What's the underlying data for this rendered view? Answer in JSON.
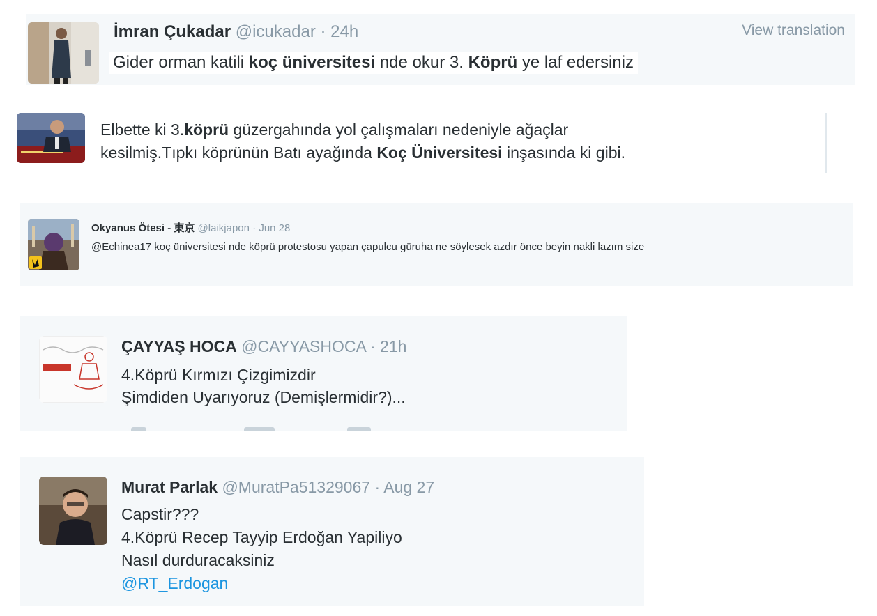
{
  "tweets": [
    {
      "name": "İmran Çukadar",
      "handle": "@icukadar",
      "sep": " · ",
      "time": "24h",
      "view_translation": "View translation",
      "text_1": "Gider orman katili ",
      "kw_1": "koç üniversitesi",
      "text_2": " nde okur 3. ",
      "kw_2": "Köprü",
      "text_3": " ye laf edersiniz"
    },
    {
      "line1_a": "Elbette ki 3.",
      "line1_kw": "köprü",
      "line1_b": " güzergahında yol çalışmaları nedeniyle ağaçlar",
      "line2_a": "kesilmiş.Tıpkı köprünün Batı ayağında ",
      "line2_kw": "Koç Üniversitesi",
      "line2_b": " inşasında ki gibi."
    },
    {
      "name": "Okyanus Ötesi - 東京",
      "handle": "@laikjapon",
      "sep": " · ",
      "time": "Jun 28",
      "text": "@Echinea17 koç üniversitesi nde köprü protestosu yapan çapulcu güruha ne söylesek azdır önce beyin nakli lazım size"
    },
    {
      "name": "ÇAYYAŞ HOCA",
      "handle": "@CAYYASHOCA",
      "sep": " · ",
      "time": "21h",
      "line1": "4.Köprü Kırmızı Çizgimizdir",
      "line2": "Şimdiden Uyarıyoruz (Demişlermidir?)..."
    },
    {
      "name": "Murat Parlak",
      "handle": "@MuratPa51329067",
      "sep": " · ",
      "time": "Aug 27",
      "line1": "Capstir???",
      "line2": "4.Köprü Recep Tayyip Erdoğan Yapiliyo",
      "line3": "Nasıl durduracaksiniz",
      "mention": "@RT_Erdogan"
    }
  ],
  "avatars": [
    "user-avatar-photo",
    "user-avatar-photo",
    "user-avatar-photo",
    "user-avatar-logo",
    "user-avatar-photo"
  ],
  "colors": {
    "card_bg": "#f5f8fa",
    "meta": "#8899a6",
    "link": "#1b95e0",
    "text": "#292f33"
  }
}
